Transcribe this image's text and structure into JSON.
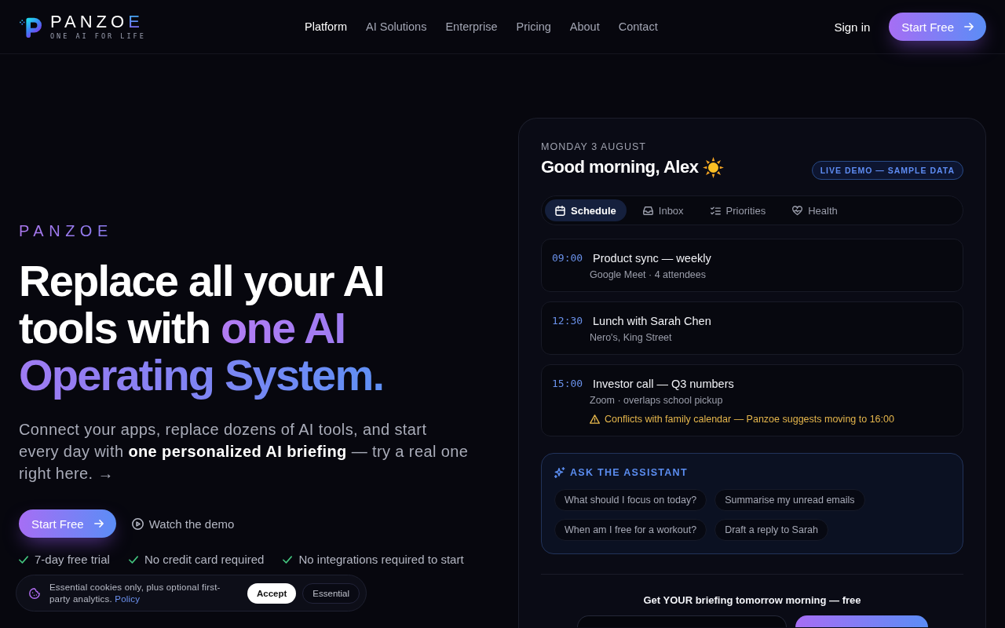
{
  "header": {
    "logo": {
      "name": "PANZOE",
      "tagline": "ONE AI FOR LIFE"
    },
    "nav": [
      {
        "label": "Platform",
        "selected": true
      },
      {
        "label": "AI Solutions",
        "selected": false
      },
      {
        "label": "Enterprise",
        "selected": false
      },
      {
        "label": "Pricing",
        "selected": false
      },
      {
        "label": "About",
        "selected": false
      },
      {
        "label": "Contact",
        "selected": false
      }
    ],
    "sign_in": "Sign in",
    "cta": "Start Free"
  },
  "hero": {
    "eyebrow": "PANZOE",
    "heading": {
      "text": "Replace all your AI tools with ",
      "highlight": "one AI Operating System."
    },
    "subtitle": "Connect your apps, replace dozens of AI tools, and start every day with **one personalized AI briefing** — try a real one right here. →",
    "primary_button": "Start Free",
    "secondary_button": "Watch the demo",
    "perks": [
      "7-day free trial",
      "No credit card required",
      "No integrations required to start"
    ]
  },
  "demo_card": {
    "date": "MONDAY 3 AUGUST",
    "greeting": "Good morning, Alex",
    "badge": "LIVE DEMO — SAMPLE DATA",
    "tabs": [
      {
        "label": "Schedule",
        "selected": true
      },
      {
        "label": "Inbox",
        "selected": false
      },
      {
        "label": "Priorities",
        "selected": false
      },
      {
        "label": "Health",
        "selected": false
      }
    ],
    "events": [
      {
        "time": "09:00",
        "title": "Product sync — weekly",
        "detail": "Google Meet · 4 attendees"
      },
      {
        "time": "12:30",
        "title": "Lunch with Sarah Chen",
        "detail": "Nero's, King Street"
      },
      {
        "time": "15:00",
        "title": "Investor call — Q3 numbers",
        "detail": "Zoom · overlaps school pickup",
        "warning": "Conflicts with family calendar — Panzoe suggests moving to 16:00"
      }
    ],
    "assistant": {
      "title": "ASK THE ASSISTANT",
      "suggestions": [
        "What should I focus on today?",
        "Summarise my unread emails",
        "When am I free for a workout?",
        "Draft a reply to Sarah"
      ]
    },
    "signup": {
      "title": "Get YOUR briefing tomorrow morning — free"
    }
  },
  "cookie_banner": {
    "text": "Essential cookies only, plus optional first-party analytics.",
    "link": "Policy",
    "buttons": [
      {
        "label": "Accept",
        "kind": "primary"
      },
      {
        "label": "Essential",
        "kind": "secondary"
      }
    ]
  }
}
